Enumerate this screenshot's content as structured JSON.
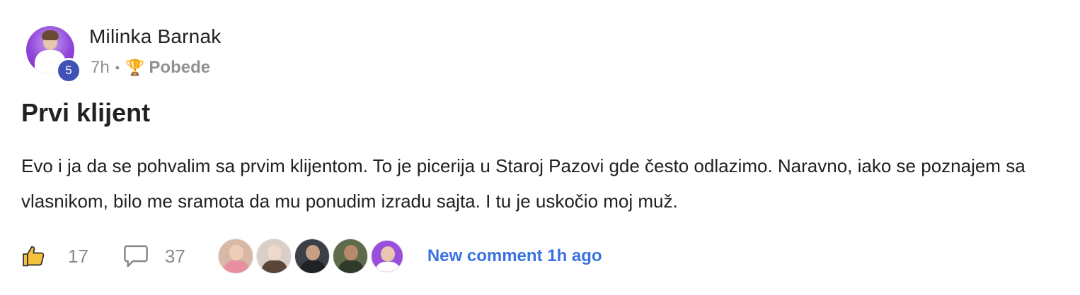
{
  "post": {
    "author": {
      "name": "Milinka Barnak",
      "level": "5"
    },
    "meta": {
      "time": "7h",
      "separator": "•",
      "category_icon": "trophy-icon",
      "category": "Pobede"
    },
    "title": "Prvi klijent",
    "body": "Evo i ja da se pohvalim sa prvim klijentom. To je picerija u Staroj Pazovi gde često odlazimo. Naravno, iako se poznajem sa vlasnikom, bilo me sramota da mu ponudim izradu sajta. I tu je uskočio moj muž.",
    "likes": "17",
    "comments": "37",
    "last_comment": "New comment 1h ago"
  },
  "colors": {
    "accent_link": "#3a73e0",
    "level_badge": "#3f51b5",
    "meta_gray": "#909090",
    "avatar_purple": "#8e44d8"
  }
}
